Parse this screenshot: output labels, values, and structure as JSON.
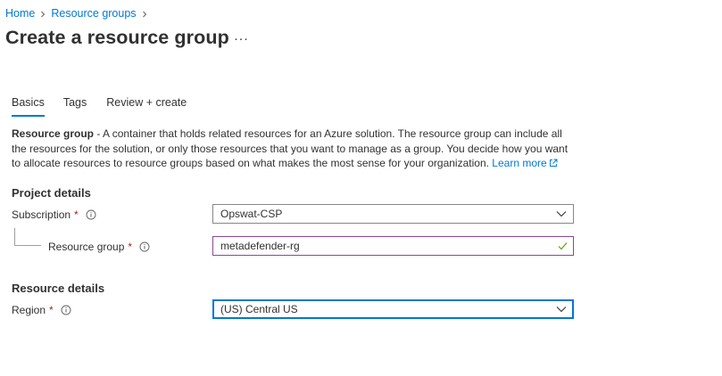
{
  "breadcrumb": {
    "items": [
      {
        "label": "Home"
      },
      {
        "label": "Resource groups"
      }
    ]
  },
  "page": {
    "title": "Create a resource group",
    "more_label": "···"
  },
  "tabs": [
    {
      "label": "Basics",
      "active": true
    },
    {
      "label": "Tags",
      "active": false
    },
    {
      "label": "Review + create",
      "active": false
    }
  ],
  "description": {
    "term": "Resource group",
    "text": " - A container that holds related resources for an Azure solution. The resource group can include all the resources for the solution, or only those resources that you want to manage as a group. You decide how you want to allocate resources to resource groups based on what makes the most sense for your organization. ",
    "link_label": "Learn more"
  },
  "project_details": {
    "heading": "Project details",
    "subscription": {
      "label": "Subscription",
      "required_mark": "*",
      "value": "Opswat-CSP"
    },
    "resource_group": {
      "label": "Resource group",
      "required_mark": "*",
      "value": "metadefender-rg",
      "valid": true
    }
  },
  "resource_details": {
    "heading": "Resource details",
    "region": {
      "label": "Region",
      "required_mark": "*",
      "value": "(US) Central US"
    }
  },
  "colors": {
    "accent": "#0078d4",
    "required": "#a4262c",
    "valid_border": "#8c4799",
    "valid_check": "#57a300",
    "text": "#323130"
  },
  "icons": {
    "breadcrumb_separator": "chevron-right-icon",
    "info": "info-icon",
    "dropdown": "chevron-down-icon",
    "valid": "checkmark-icon",
    "external_link": "external-link-icon",
    "more": "more-ellipsis-icon"
  }
}
